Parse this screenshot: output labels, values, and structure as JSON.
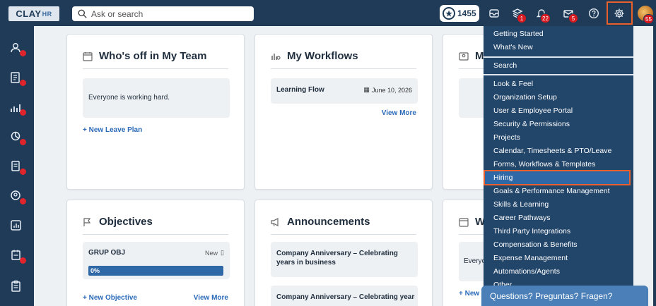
{
  "topbar": {
    "logo": "CLAY",
    "logo_suffix": "HR",
    "search_placeholder": "Ask or search",
    "points": "1455",
    "badges": {
      "layers": "1",
      "bell": "22",
      "mail": "5",
      "avatar": "55"
    }
  },
  "sidebar": {
    "items": [
      "people-icon",
      "reports-icon",
      "analytics-icon",
      "goals-icon",
      "documents-icon",
      "profile-icon",
      "dashboard-icon",
      "time-icon",
      "clipboard-icon"
    ]
  },
  "cards": {
    "whos_off": {
      "title": "Who's off in My Team",
      "message": "Everyone is working hard.",
      "link": "+ New Leave Plan"
    },
    "workflows": {
      "title": "My Workflows",
      "item_name": "Learning Flow",
      "item_date": "June 10, 2026",
      "link": "View More"
    },
    "third": {
      "title": "M"
    },
    "objectives": {
      "title": "Objectives",
      "item_name": "GRUP OBJ",
      "item_status": "New",
      "progress_label": "0%",
      "progress": 0,
      "link_new": "+ New Objective",
      "link_more": "View More"
    },
    "announcements": {
      "title": "Announcements",
      "item1": "Company Anniversary – Celebrating years in business",
      "item2": "Company Anniversary – Celebrating years"
    },
    "sixth": {
      "title": "W",
      "text": "Everyo",
      "link": "+ New L"
    }
  },
  "dropdown": {
    "group1": [
      "Getting Started",
      "What's New"
    ],
    "group2": [
      "Search"
    ],
    "group3": [
      "Look & Feel",
      "Organization Setup",
      "User & Employee Portal",
      "Security & Permissions",
      "Projects",
      "Calendar, Timesheets & PTO/Leave",
      "Forms, Workflows & Templates",
      "Hiring",
      "Goals & Performance Management",
      "Skills & Learning",
      "Career Pathways",
      "Third Party Integrations",
      "Compensation & Benefits",
      "Expense Management",
      "Automations/Agents",
      "Other"
    ]
  },
  "chat": {
    "label": "Questions? Preguntas? Fragen?"
  },
  "colors": {
    "nav": "#1f3b57",
    "dropdown": "#22456a",
    "highlight": "#e8602c",
    "selected": "#2f68a6",
    "badge": "#d71920",
    "link": "#2a6ab8"
  }
}
